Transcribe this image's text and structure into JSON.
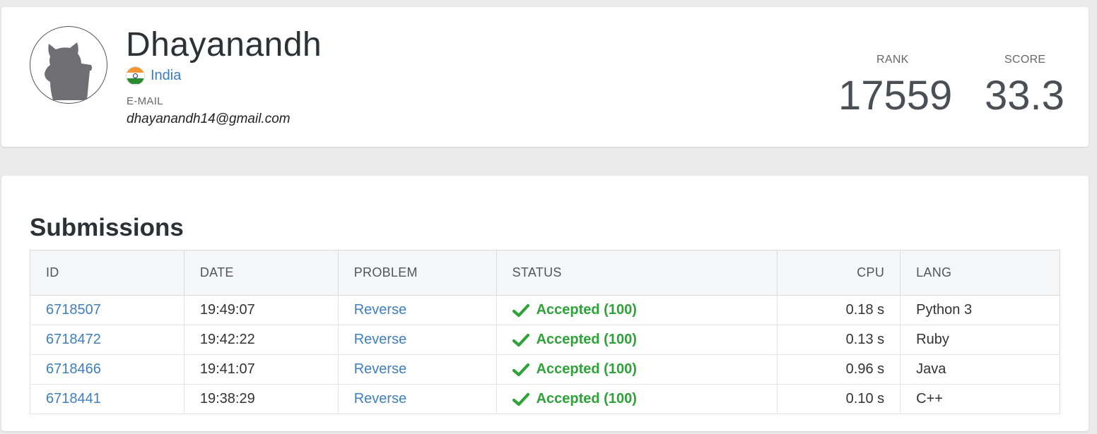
{
  "profile": {
    "name": "Dhayanandh",
    "country": "India",
    "email_label": "E-MAIL",
    "email": "dhayanandh14@gmail.com",
    "rank_label": "RANK",
    "rank": "17559",
    "score_label": "SCORE",
    "score": "33.3"
  },
  "submissions": {
    "title": "Submissions",
    "headers": {
      "id": "ID",
      "date": "DATE",
      "problem": "PROBLEM",
      "status": "STATUS",
      "cpu": "CPU",
      "lang": "LANG"
    },
    "rows": [
      {
        "id": "6718507",
        "date": "19:49:07",
        "problem": "Reverse",
        "status": "Accepted (100)",
        "cpu": "0.18 s",
        "lang": "Python 3"
      },
      {
        "id": "6718472",
        "date": "19:42:22",
        "problem": "Reverse",
        "status": "Accepted (100)",
        "cpu": "0.13 s",
        "lang": "Ruby"
      },
      {
        "id": "6718466",
        "date": "19:41:07",
        "problem": "Reverse",
        "status": "Accepted (100)",
        "cpu": "0.96 s",
        "lang": "Java"
      },
      {
        "id": "6718441",
        "date": "19:38:29",
        "problem": "Reverse",
        "status": "Accepted (100)",
        "cpu": "0.10 s",
        "lang": "C++"
      }
    ]
  },
  "icons": {
    "avatar": "cat-silhouette-icon",
    "flag": "india-flag-icon",
    "status": "checkmark-icon"
  },
  "colors": {
    "link": "#3f7fbf",
    "accepted": "#2ea33a",
    "background": "#ebebeb"
  }
}
